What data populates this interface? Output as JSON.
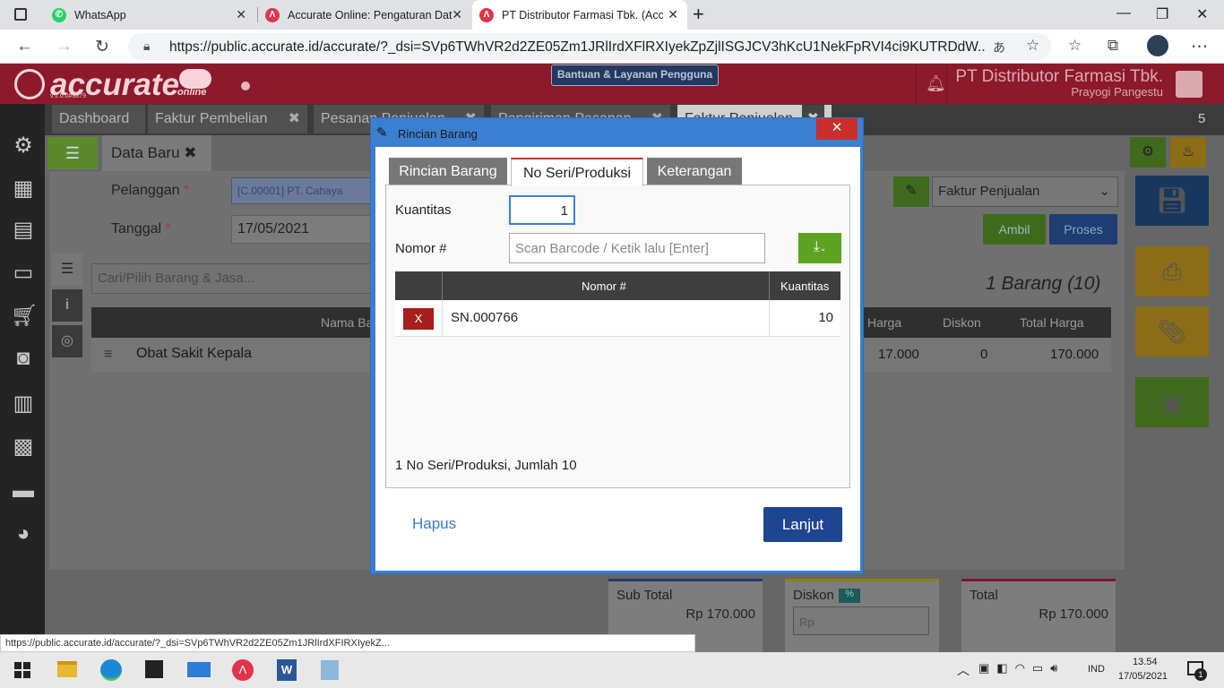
{
  "browser": {
    "tabs": [
      {
        "title": "WhatsApp",
        "color": "#25d366"
      },
      {
        "title": "Accurate Online: Pengaturan Dat",
        "color": "#e0344b"
      },
      {
        "title": "PT Distributor Farmasi Tbk. (Accu",
        "color": "#e0344b"
      }
    ],
    "url": "https://public.accurate.id/accurate/?_dsi=SVp6TWhVR2d2ZE05Zm1JRlIrdXFlRXIyekZpZjlISGJCV3hKcU1NekFpRVI4ci9KUTRDdW...",
    "status_url": "https://public.accurate.id/accurate/?_dsi=SVp6TWhVR2d2ZE05Zm1JRlIrdXFIRXIyekZ..."
  },
  "app": {
    "logo": "accurate",
    "logo_sub": "online",
    "version": "v.1.0.0#9879",
    "help": "Bantuan & Layanan Pengguna",
    "company": "PT Distributor Farmasi Tbk.",
    "user": "Prayogi Pangestu",
    "tabs": [
      "Dashboard",
      "Faktur Pembelian",
      "Pesanan Penjualan",
      "Pengiriman Pesanan",
      "Faktur Penjualan"
    ],
    "tab_count": "5"
  },
  "form": {
    "doc_tab": "Data Baru",
    "pelanggan_label": "Pelanggan",
    "pelanggan_value": "[C.00001] PT. Cahaya",
    "tanggal_label": "Tanggal",
    "tanggal_value": "17/05/2021",
    "type_value": "Faktur Penjualan",
    "ambil": "Ambil",
    "proses": "Proses",
    "search_placeholder": "Cari/Pilih Barang & Jasa...",
    "count": "1 Barang (10)",
    "columns": [
      "Nama Barang",
      "Harga",
      "Diskon",
      "Total Harga"
    ],
    "rows": [
      {
        "name": "Obat Sakit Kepala",
        "harga": "17.000",
        "diskon": "0",
        "total": "170.000"
      }
    ],
    "subtotal_label": "Sub Total",
    "subtotal": "Rp 170.000",
    "diskon_label": "Diskon",
    "diskon_pct": "%",
    "diskon_placeholder": "Rp",
    "total_label": "Total",
    "total": "Rp 170.000"
  },
  "modal": {
    "title": "Rincian Barang",
    "tabs": [
      "Rincian Barang",
      "No Seri/Produksi",
      "Keterangan"
    ],
    "kuantitas_label": "Kuantitas",
    "kuantitas_value": "1",
    "nomor_label": "Nomor #",
    "nomor_placeholder": "Scan Barcode / Ketik lalu [Enter]",
    "columns": [
      "Nomor #",
      "Kuantitas"
    ],
    "rows": [
      {
        "del": "X",
        "nomor": "SN.000766",
        "qty": "10"
      }
    ],
    "summary": "1 No Seri/Produksi, Jumlah 10",
    "hapus": "Hapus",
    "lanjut": "Lanjut"
  },
  "taskbar": {
    "lang": "IND",
    "time": "13.54",
    "date": "17/05/2021",
    "notif": "1"
  }
}
